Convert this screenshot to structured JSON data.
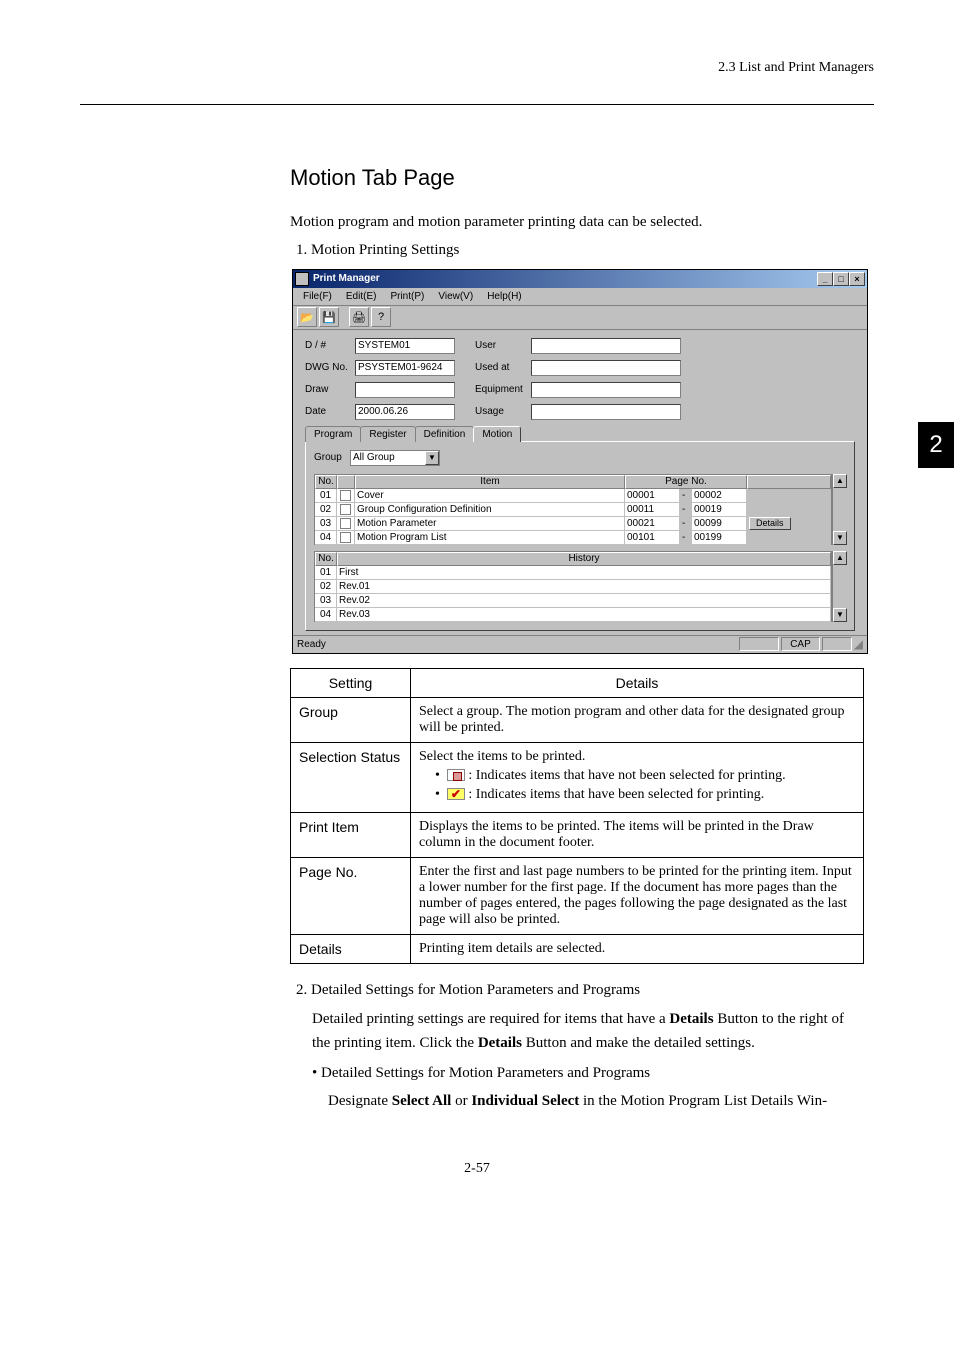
{
  "header": {
    "section": "2.3  List and Print Managers"
  },
  "sideTab": "2",
  "heading": "Motion Tab Page",
  "intro": "Motion program and motion parameter printing data can be selected.",
  "steps": {
    "s1": "1.  Motion Printing Settings",
    "s2": "2.  Detailed Settings for Motion Parameters and Programs",
    "s2_p1a": "Detailed printing settings are required for items that have a ",
    "s2_p1_bold1": "Details",
    "s2_p1b": " Button to the right of the printing item. Click the ",
    "s2_p1_bold2": "Details",
    "s2_p1c": " Button and make the detailed settings.",
    "s2_b1": "•  Detailed Settings for Motion Parameters and Programs",
    "s2_b1_p_a": "Designate ",
    "s2_b1_bold1": "Select All",
    "s2_b1_p_b": " or ",
    "s2_b1_bold2": "Individual Select",
    "s2_b1_p_c": " in the Motion Program List Details Win-"
  },
  "app": {
    "title": "Print Manager",
    "menus": {
      "file": "File(F)",
      "edit": "Edit(E)",
      "print": "Print(P)",
      "view": "View(V)",
      "help": "Help(H)"
    },
    "form": {
      "l_dh": "D / #",
      "v_dh": "SYSTEM01",
      "l_dwg": "DWG No.",
      "v_dwg": "PSYSTEM01-9624",
      "l_draw": "Draw",
      "v_draw": "",
      "l_date": "Date",
      "v_date": "2000.06.26",
      "l_user": "User",
      "l_usedat": "Used at",
      "l_equip": "Equipment",
      "l_usage": "Usage"
    },
    "tabs": {
      "program": "Program",
      "register": "Register",
      "definition": "Definition",
      "motion": "Motion"
    },
    "group": {
      "label": "Group",
      "value": "All Group"
    },
    "grid1": {
      "h_no": "No.",
      "h_item": "Item",
      "h_page": "Page No.",
      "rows": [
        {
          "no": "01",
          "item": "Cover",
          "p1": "00001",
          "p2": "00002",
          "details": false
        },
        {
          "no": "02",
          "item": "Group Configuration Definition",
          "p1": "00011",
          "p2": "00019",
          "details": false
        },
        {
          "no": "03",
          "item": "Motion Parameter",
          "p1": "00021",
          "p2": "00099",
          "details": true
        },
        {
          "no": "04",
          "item": "Motion Program List",
          "p1": "00101",
          "p2": "00199",
          "details": false
        }
      ],
      "details_label": "Details"
    },
    "grid2": {
      "h_no": "No.",
      "h_hist": "History",
      "rows": [
        {
          "no": "01",
          "h": "First"
        },
        {
          "no": "02",
          "h": "Rev.01"
        },
        {
          "no": "03",
          "h": "Rev.02"
        },
        {
          "no": "04",
          "h": "Rev.03"
        }
      ]
    },
    "status": {
      "ready": "Ready",
      "cap": "CAP"
    }
  },
  "settingsTable": {
    "h1": "Setting",
    "h2": "Details",
    "rows": {
      "group": {
        "name": "Group",
        "desc": "Select a group. The motion program and other data for the designated group will be printed."
      },
      "selstat": {
        "name": "Selection Status",
        "line1": "Select the items to be printed.",
        "unsel": " : Indicates items that have not been selected for printing.",
        "sel": " : Indicates items that have been selected for printing."
      },
      "printitem": {
        "name": "Print Item",
        "desc": "Displays the items to be printed. The items will be printed in the Draw column in the document footer."
      },
      "pageno": {
        "name": "Page No.",
        "desc": "Enter the first and last page numbers to be printed for the printing item. Input a lower number for the first page. If the document has more pages than the number of pages entered, the pages following the page designated as the last page will also be printed."
      },
      "details": {
        "name": "Details",
        "desc": "Printing item details are selected."
      }
    }
  },
  "footer": "2-57"
}
